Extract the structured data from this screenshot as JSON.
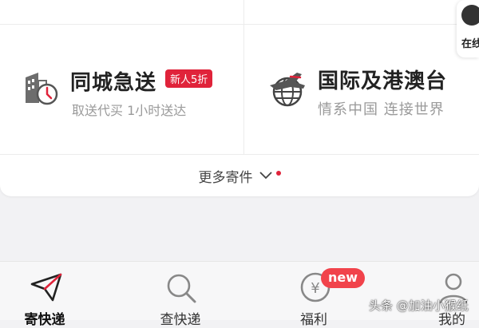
{
  "services": [
    {
      "title": "同城急送",
      "subtitle": "取送代买 1小时送达",
      "badge": "新人5折",
      "icon": "city-delivery-clock-icon"
    },
    {
      "title": "国际及港澳台",
      "subtitle": "情系中国 连接世界",
      "icon": "globe-plane-icon"
    }
  ],
  "more": {
    "label": "更多寄件",
    "icon": "chevron-down-icon",
    "dot_color": "#e0233a"
  },
  "online_service": {
    "label": "在线",
    "icon": "customer-service-icon"
  },
  "tabbar": {
    "tabs": [
      {
        "label": "寄快递",
        "icon": "paper-plane-icon"
      },
      {
        "label": "查快递",
        "icon": "search-icon"
      },
      {
        "label": "福利",
        "icon": "yen-coin-icon"
      },
      {
        "label": "我的",
        "icon": "user-icon"
      }
    ],
    "new_badge": "new"
  },
  "watermark": "头条 @加油小猴纸",
  "colors": {
    "accent": "#e0233a",
    "badge": "#f1434b"
  }
}
